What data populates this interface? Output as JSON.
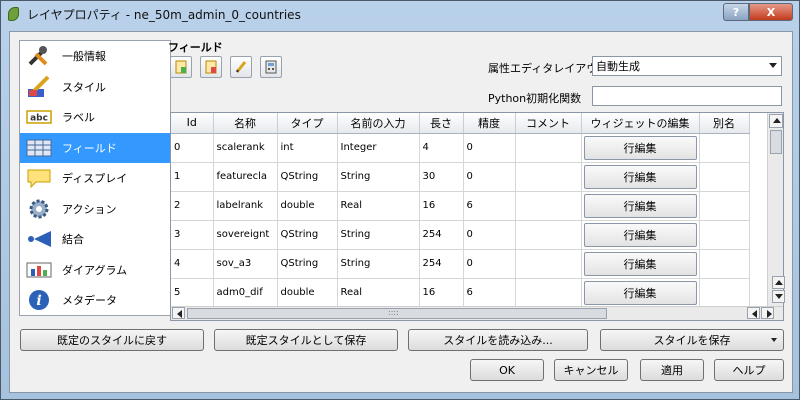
{
  "window": {
    "title": "レイヤプロパティ - ne_50m_admin_0_countries",
    "help_label": "?",
    "close_label": "X"
  },
  "nav": {
    "items": [
      {
        "label": "一般情報",
        "icon": "tools-icon"
      },
      {
        "label": "スタイル",
        "icon": "brush-icon"
      },
      {
        "label": "ラベル",
        "icon": "abc-icon"
      },
      {
        "label": "フィールド",
        "icon": "table-icon",
        "selected": true
      },
      {
        "label": "ディスプレイ",
        "icon": "speech-bubble-icon"
      },
      {
        "label": "アクション",
        "icon": "gear-icon"
      },
      {
        "label": "結合",
        "icon": "join-icon"
      },
      {
        "label": "ダイアグラム",
        "icon": "diagram-icon"
      },
      {
        "label": "メタデータ",
        "icon": "info-icon"
      }
    ]
  },
  "fields": {
    "title": "フィールド",
    "layout_label": "属性エディタレイアウト:",
    "layout_value": "自動生成",
    "python_label": "Python初期化関数",
    "python_value": "",
    "columns": [
      "Id",
      "名称",
      "タイプ",
      "名前の入力",
      "長さ",
      "精度",
      "コメント",
      "ウィジェットの編集",
      "別名"
    ],
    "rows": [
      [
        "0",
        "scalerank",
        "int",
        "Integer",
        "4",
        "0",
        "",
        "行編集",
        ""
      ],
      [
        "1",
        "featurecla",
        "QString",
        "String",
        "30",
        "0",
        "",
        "行編集",
        ""
      ],
      [
        "2",
        "labelrank",
        "double",
        "Real",
        "16",
        "6",
        "",
        "行編集",
        ""
      ],
      [
        "3",
        "sovereignt",
        "QString",
        "String",
        "254",
        "0",
        "",
        "行編集",
        ""
      ],
      [
        "4",
        "sov_a3",
        "QString",
        "String",
        "254",
        "0",
        "",
        "行編集",
        ""
      ],
      [
        "5",
        "adm0_dif",
        "double",
        "Real",
        "16",
        "6",
        "",
        "行編集",
        ""
      ]
    ],
    "grip": "::::"
  },
  "style_buttons": {
    "restore": "既定のスタイルに戻す",
    "save_default": "既定スタイルとして保存",
    "load": "スタイルを読み込み...",
    "save": "スタイルを保存"
  },
  "dialog_buttons": {
    "ok": "OK",
    "cancel": "キャンセル",
    "apply": "適用",
    "help": "ヘルプ"
  },
  "colors": {
    "selection": "#3399ff",
    "titlebar": "#b9d1ea",
    "close": "#c43a1d"
  }
}
